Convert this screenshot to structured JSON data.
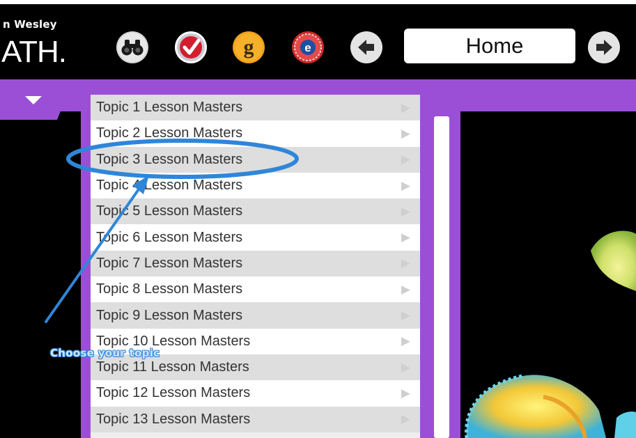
{
  "brand": {
    "line1": "n Wesley",
    "line2": "ATH."
  },
  "toolbar": {
    "tools": [
      {
        "name": "binoculars-icon",
        "bg": "#d8d8d8"
      },
      {
        "name": "checkmark-icon",
        "bg": "#ffffff"
      },
      {
        "name": "glossary-icon",
        "letter": "g",
        "bg": "#f0a21d"
      },
      {
        "name": "etext-icon",
        "letter": "e",
        "bg": "#cc2a2a"
      }
    ],
    "back_icon": "arrow-left-icon",
    "forward_icon": "arrow-right-icon",
    "location": "Home"
  },
  "menu": {
    "toggle_icon": "triangle-down-icon"
  },
  "topics": [
    "Topic 1 Lesson Masters",
    "Topic 2 Lesson Masters",
    "Topic 3 Lesson Masters",
    "Topic 4 Lesson Masters",
    "Topic 5 Lesson Masters",
    "Topic 6 Lesson Masters",
    "Topic 7 Lesson Masters",
    "Topic 8 Lesson Masters",
    "Topic 9 Lesson Masters",
    "Topic 10 Lesson Masters",
    "Topic 11 Lesson Masters",
    "Topic 12 Lesson Masters",
    "Topic 13 Lesson Masters"
  ],
  "annotation": {
    "callout": "Choose your topic",
    "color": "#2f86d8"
  },
  "colors": {
    "purple": "#9b4fd6",
    "header": "#000000"
  }
}
